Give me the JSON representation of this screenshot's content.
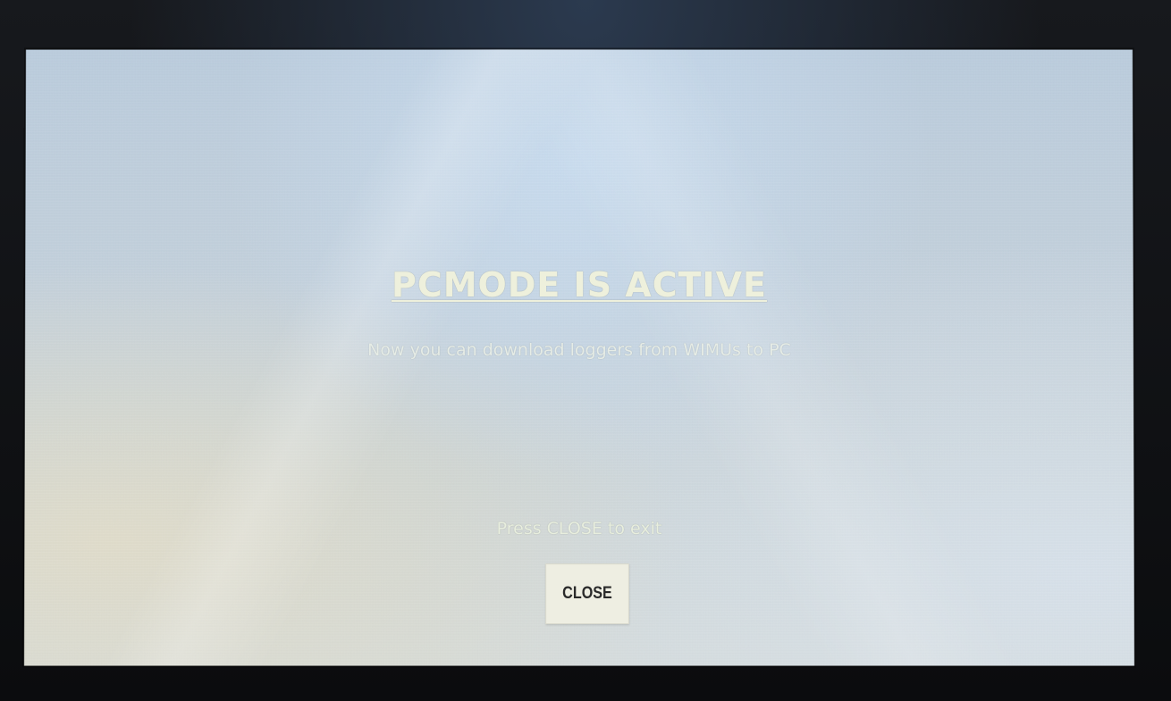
{
  "dialog": {
    "title": "PCMODE IS ACTIVE",
    "message": "Now you can download loggers from WIMUs to PC",
    "exit_hint": "Press CLOSE to exit",
    "close_label": "CLOSE"
  },
  "colors": {
    "screen_background": "#c3d0da",
    "title_text": "#eef0dc",
    "button_background": "#eeeee2",
    "button_text": "#2a2a2a"
  }
}
